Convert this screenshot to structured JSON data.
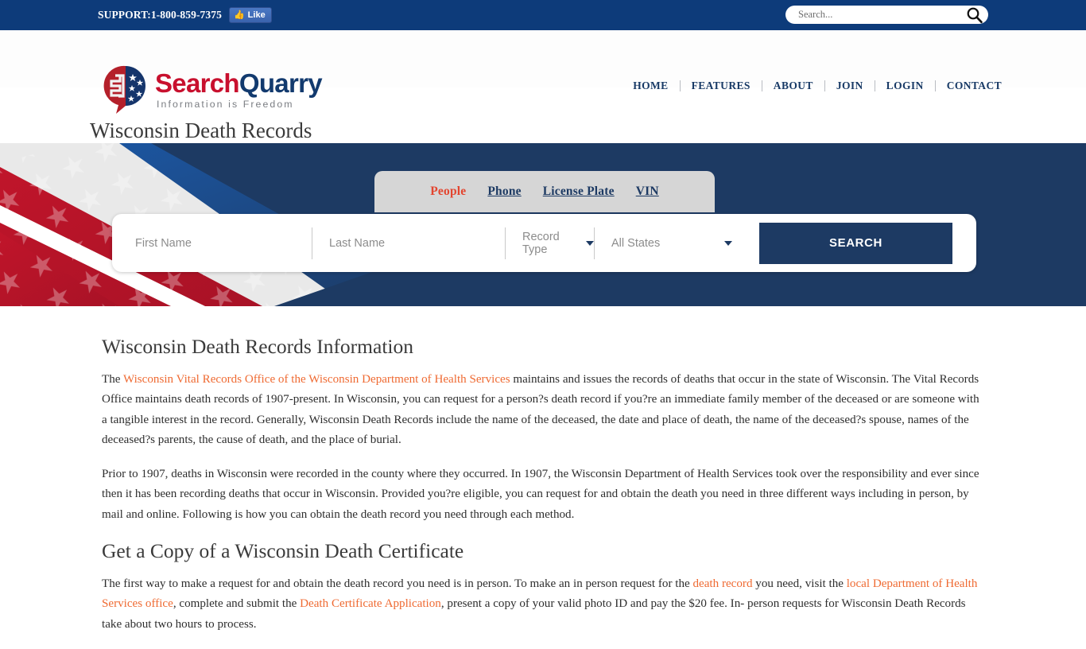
{
  "topbar": {
    "support_text": "SUPPORT:1-800-859-7375",
    "like_label": "Like",
    "thumb_icon": "thumbs-up-icon",
    "search_placeholder": "Search...",
    "search_value": "",
    "search_icon": "magnifier-icon",
    "background_color": "#0d3b7a"
  },
  "header": {
    "logo": {
      "word_first": "Search",
      "word_second": "Quarry",
      "tagline": "Information is Freedom",
      "mark_icon": "searchquarry-shield-logo-icon",
      "color_red": "#c8102e",
      "color_navy": "#123a6e"
    },
    "nav": [
      {
        "label": "HOME"
      },
      {
        "label": "FEATURES"
      },
      {
        "label": "ABOUT"
      },
      {
        "label": "JOIN"
      },
      {
        "label": "LOGIN"
      },
      {
        "label": "CONTACT"
      }
    ]
  },
  "page_title": "Wisconsin Death Records",
  "hero": {
    "tabs": [
      {
        "label": "People",
        "active": true
      },
      {
        "label": "Phone",
        "active": false
      },
      {
        "label": "License Plate",
        "active": false
      },
      {
        "label": "VIN",
        "active": false
      }
    ],
    "form": {
      "first_name_placeholder": "First Name",
      "first_name_value": "",
      "last_name_placeholder": "Last Name",
      "last_name_value": "",
      "record_type_label": "Record Type",
      "state_label": "All States",
      "search_button": "SEARCH"
    },
    "background_color": "#1d3a63",
    "tabbar_color": "#d6d6d6",
    "active_tab_color": "#e3452f"
  },
  "content": {
    "heading1": "Wisconsin Death Records Information",
    "para1": {
      "pre": "The ",
      "link1": "Wisconsin Vital Records Office of the Wisconsin Department of Health Services",
      "post": " maintains and issues the records of deaths that occur in the state of Wisconsin. The Vital Records Office maintains death records of 1907-present. In Wisconsin, you can request for a person?s death record if you?re an immediate family member of the deceased or are someone with a tangible interest in the record. Generally, Wisconsin Death Records include the name of the deceased, the date and place of death, the name of the deceased?s spouse, names of the deceased?s parents, the cause of death, and the place of burial."
    },
    "para2": "Prior to 1907, deaths in Wisconsin were recorded in the county where they occurred. In 1907, the Wisconsin Department of Health Services took over the responsibility and ever since then it has been recording deaths that occur in Wisconsin. Provided you?re eligible, you can request for and obtain the death you need in three different ways including in person, by mail and online. Following is how you can obtain the death record you need through each method.",
    "heading2": "Get a Copy of a Wisconsin Death Certificate",
    "para3": {
      "t1": "The first way to make a request for and obtain the death record you need is in person. To make an in person request for the ",
      "link1": "death record",
      "t2": " you need, visit the ",
      "link2": "local Department of Health Services office",
      "t3": ", complete and submit the ",
      "link3": "Death Certificate Application",
      "t4": ", present a copy of your valid photo ID and pay the $20 fee. In- person requests for Wisconsin Death Records take about two hours to process."
    },
    "link_color": "#ef6a32"
  }
}
